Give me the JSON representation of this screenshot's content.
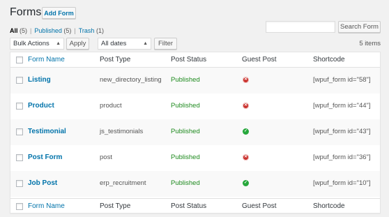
{
  "header": {
    "title": "Forms",
    "add_new": "Add Form"
  },
  "views": [
    {
      "label": "All",
      "count": "(5)"
    },
    {
      "label": "Published",
      "count": "(5)"
    },
    {
      "label": "Trash",
      "count": "(1)"
    }
  ],
  "search": {
    "placeholder": "",
    "button": "Search Form"
  },
  "actions": {
    "bulk_selected": "Bulk Actions",
    "apply": "Apply",
    "dates_selected": "All dates",
    "filter": "Filter",
    "items_count": "5 items"
  },
  "columns": [
    "Form Name",
    "Post Type",
    "Post Status",
    "Guest Post",
    "Shortcode"
  ],
  "rows": [
    {
      "name": "Listing",
      "post_type": "new_directory_listing",
      "status": "Published",
      "guest": "no",
      "shortcode": "[wpuf_form id=\"58\"]"
    },
    {
      "name": "Product",
      "post_type": "product",
      "status": "Published",
      "guest": "no",
      "shortcode": "[wpuf_form id=\"44\"]"
    },
    {
      "name": "Testimonial",
      "post_type": "js_testimonials",
      "status": "Published",
      "guest": "yes",
      "shortcode": "[wpuf_form id=\"43\"]"
    },
    {
      "name": "Post Form",
      "post_type": "post",
      "status": "Published",
      "guest": "no",
      "shortcode": "[wpuf_form id=\"36\"]"
    },
    {
      "name": "Job Post",
      "post_type": "erp_recruitment",
      "status": "Published",
      "guest": "yes",
      "shortcode": "[wpuf_form id=\"10\"]"
    }
  ],
  "icons": {
    "guest_no": "x-circle-icon",
    "guest_yes": "check-circle-icon"
  },
  "colors": {
    "link": "#0073aa",
    "published": "#1e8a1e",
    "guest_no": "#c9302c",
    "guest_yes": "#27a83c"
  }
}
